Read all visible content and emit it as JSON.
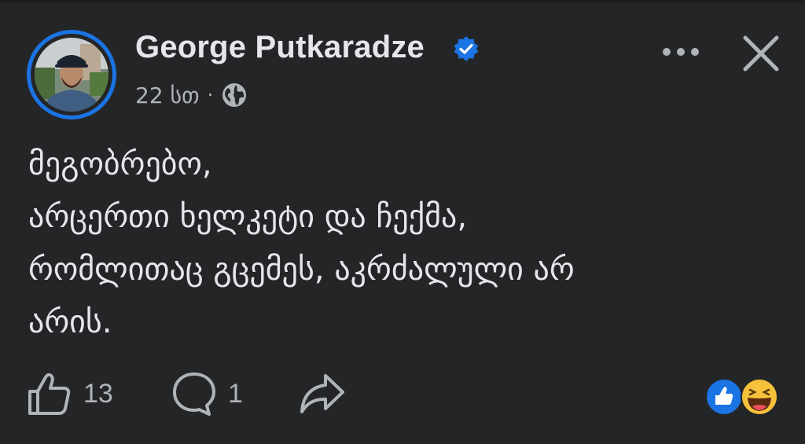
{
  "post": {
    "author": "George Putkaradze",
    "verified": true,
    "time": "22 სთ",
    "separator": "·",
    "audience_icon": "globe-icon",
    "body_lines": [
      "მეგობრებო,",
      "არცერთი ხელკეტი და ჩექმა,",
      "რომლითაც გცემეს, აკრძალული არ",
      "არის."
    ]
  },
  "actions": {
    "like_count": "13",
    "comment_count": "1"
  },
  "reactions": [
    "like-reaction-icon",
    "haha-reaction-icon"
  ],
  "colors": {
    "background": "#242526",
    "accent": "#1b74e4",
    "text": "#e4e6eb",
    "secondary_text": "#b0b3b8"
  }
}
